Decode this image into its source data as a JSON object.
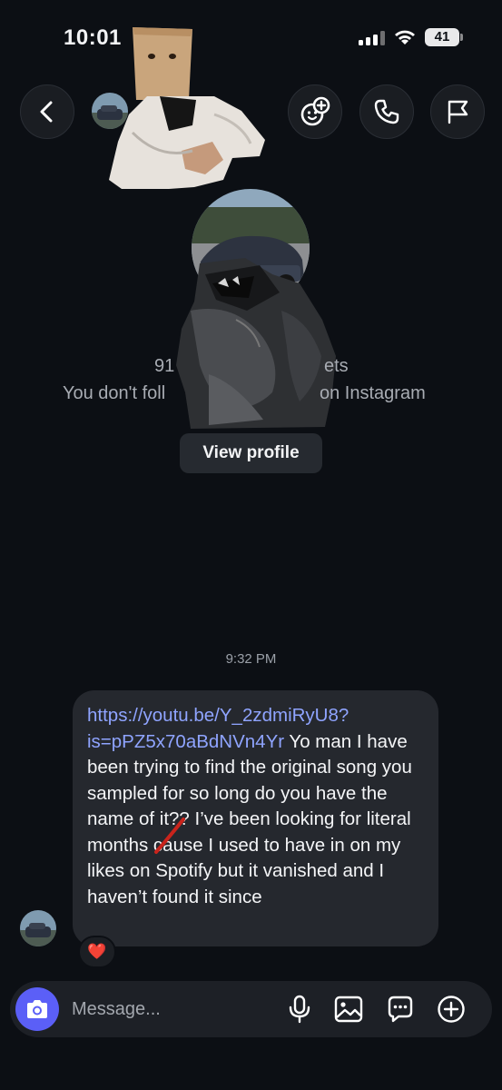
{
  "status_bar": {
    "time": "10:01",
    "battery": "41"
  },
  "header": {
    "back_icon": "chevron-left-icon",
    "action_icons": [
      "add-effects-icon",
      "phone-icon",
      "flag-icon"
    ]
  },
  "profile": {
    "stats_left": "91",
    "stats_right": "ets",
    "follow_left": "You don't foll",
    "follow_right": "on Instagram",
    "view_profile_label": "View profile"
  },
  "thread": {
    "timestamp": "9:32 PM",
    "message": {
      "link": "https://youtu.be/Y_2zdmiRyU8?is=pPZ5x70aBdNVn4Yr",
      "text": " Yo man I have been trying to find the original song you sampled for so long do you have the name of it?? I’ve been looking for literal months cause I used to have in on my likes on Spotify but it vanished and I haven’t found it since",
      "reaction": "❤️"
    }
  },
  "composer": {
    "placeholder": "Message...",
    "icons": [
      "camera-icon",
      "microphone-icon",
      "gallery-icon",
      "sticker-icon",
      "plus-icon"
    ],
    "camera_color": "#5b5ff7"
  },
  "colors": {
    "background": "#0c0f14",
    "bubble": "#25282e",
    "link": "#8fa4ff"
  }
}
